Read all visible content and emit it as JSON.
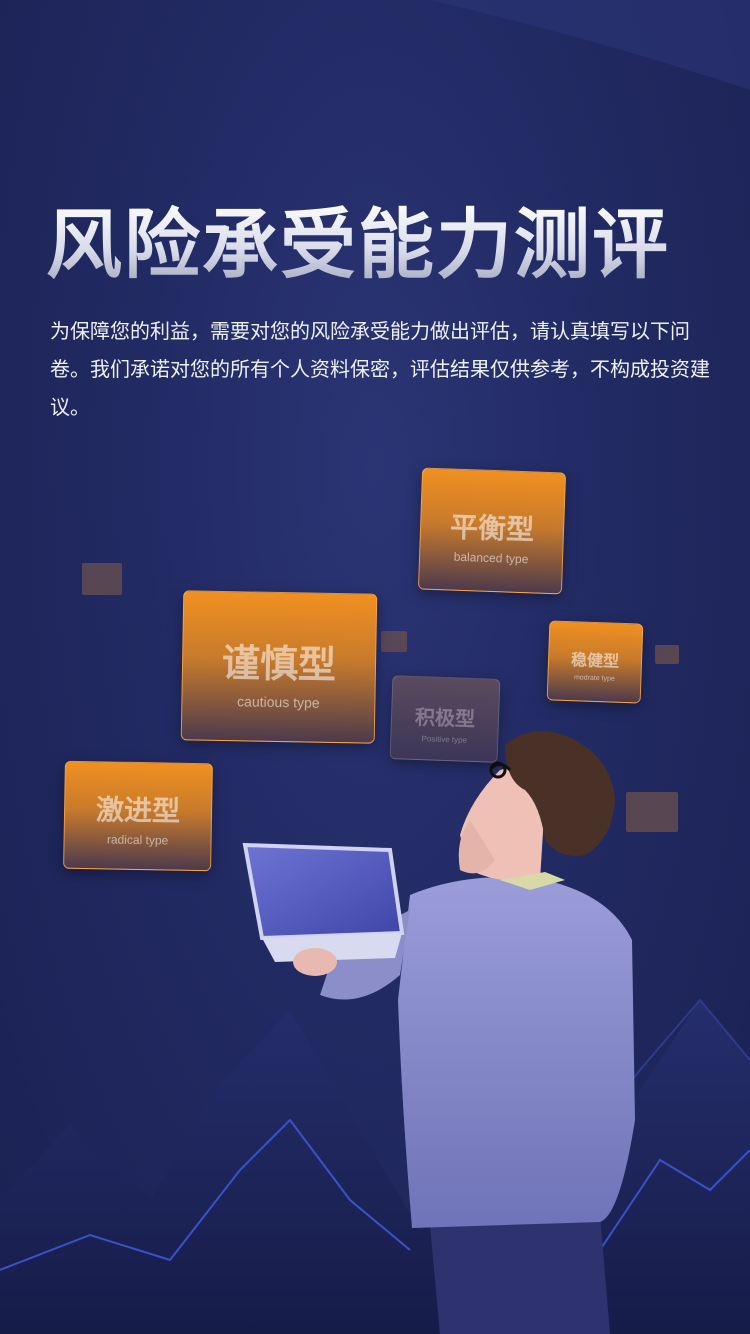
{
  "page": {
    "title": "风险承受能力测评",
    "intro": "为保障您的利益，需要对您的风险承受能力做出评估，请认真填写以下问卷。我们承诺对您的所有个人资料保密，评估结果仅供参考，不构成投资建议。"
  },
  "cards": {
    "balanced": {
      "cn": "平衡型",
      "en": "balanced type"
    },
    "cautious": {
      "cn": "谨慎型",
      "en": "cautious type"
    },
    "moderate": {
      "cn": "稳健型",
      "en": "modrate type"
    },
    "positive": {
      "cn": "积极型",
      "en": "Positive type"
    },
    "radical": {
      "cn": "激进型",
      "en": "radical type"
    }
  },
  "colors": {
    "background": "#222a63",
    "card_orange": "#f09020",
    "accent_line": "#3a52c8",
    "jacket": "#8f92cf"
  }
}
